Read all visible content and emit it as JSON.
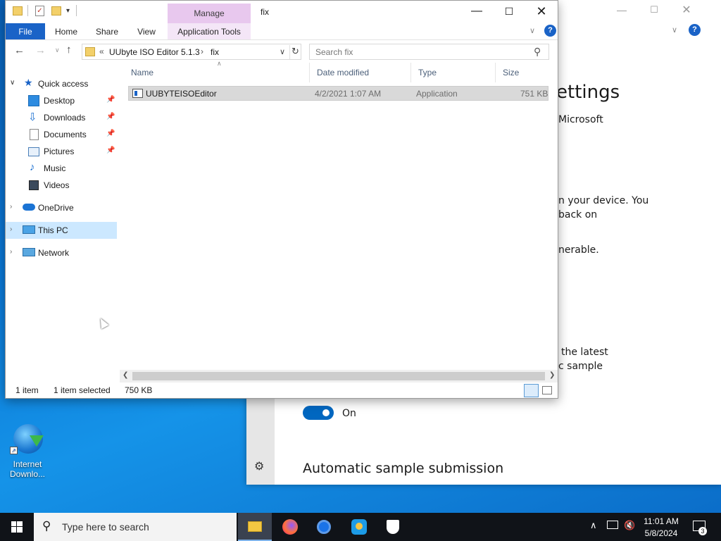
{
  "explorer": {
    "title": "fix",
    "contextual_tab": "Manage",
    "ribbon_tabs": {
      "file": "File",
      "home": "Home",
      "share": "Share",
      "view": "View",
      "app_tools": "Application Tools"
    },
    "breadcrumb": {
      "overflow": "«",
      "segments": [
        "UUbyte ISO Editor 5.1.3",
        "fix"
      ],
      "separator": "›"
    },
    "search": {
      "placeholder": "Search fix"
    },
    "nav": {
      "quick_access": "Quick access",
      "items": [
        {
          "label": "Desktop",
          "pinned": true
        },
        {
          "label": "Downloads",
          "pinned": true
        },
        {
          "label": "Documents",
          "pinned": true
        },
        {
          "label": "Pictures",
          "pinned": true
        },
        {
          "label": "Music",
          "pinned": false
        },
        {
          "label": "Videos",
          "pinned": false
        }
      ],
      "onedrive": "OneDrive",
      "this_pc": "This PC",
      "network": "Network"
    },
    "columns": {
      "name": "Name",
      "date": "Date modified",
      "type": "Type",
      "size": "Size"
    },
    "files": [
      {
        "name": "UUBYTEISOEditor",
        "date": "4/2/2021 1:07 AM",
        "type": "Application",
        "size": "751 KB"
      }
    ],
    "status": {
      "count": "1 item",
      "selected": "1 item selected",
      "selected_size": "750 KB"
    }
  },
  "settings_window": {
    "heading_fragment": "ettings",
    "line_microsoft": "Microsoft",
    "line_device": "n your device. You",
    "line_back_on": "back on",
    "line_vulnerable": "nerable.",
    "line_latest": "the latest",
    "line_sample": "c sample",
    "toggle_label": "On",
    "toggle_on": true,
    "section_heading": "Automatic sample submission"
  },
  "desktop": {
    "icon_label_line1": "Internet",
    "icon_label_line2": "Downlo..."
  },
  "taskbar": {
    "search_placeholder": "Type here to search",
    "time": "11:01 AM",
    "date": "5/8/2024",
    "notification_count": "3"
  },
  "colors": {
    "accent": "#1a63c7",
    "selection": "#cce8ff",
    "manage_tab": "#e8c8ee",
    "taskbar": "#101318",
    "toggle": "#0067c0"
  }
}
